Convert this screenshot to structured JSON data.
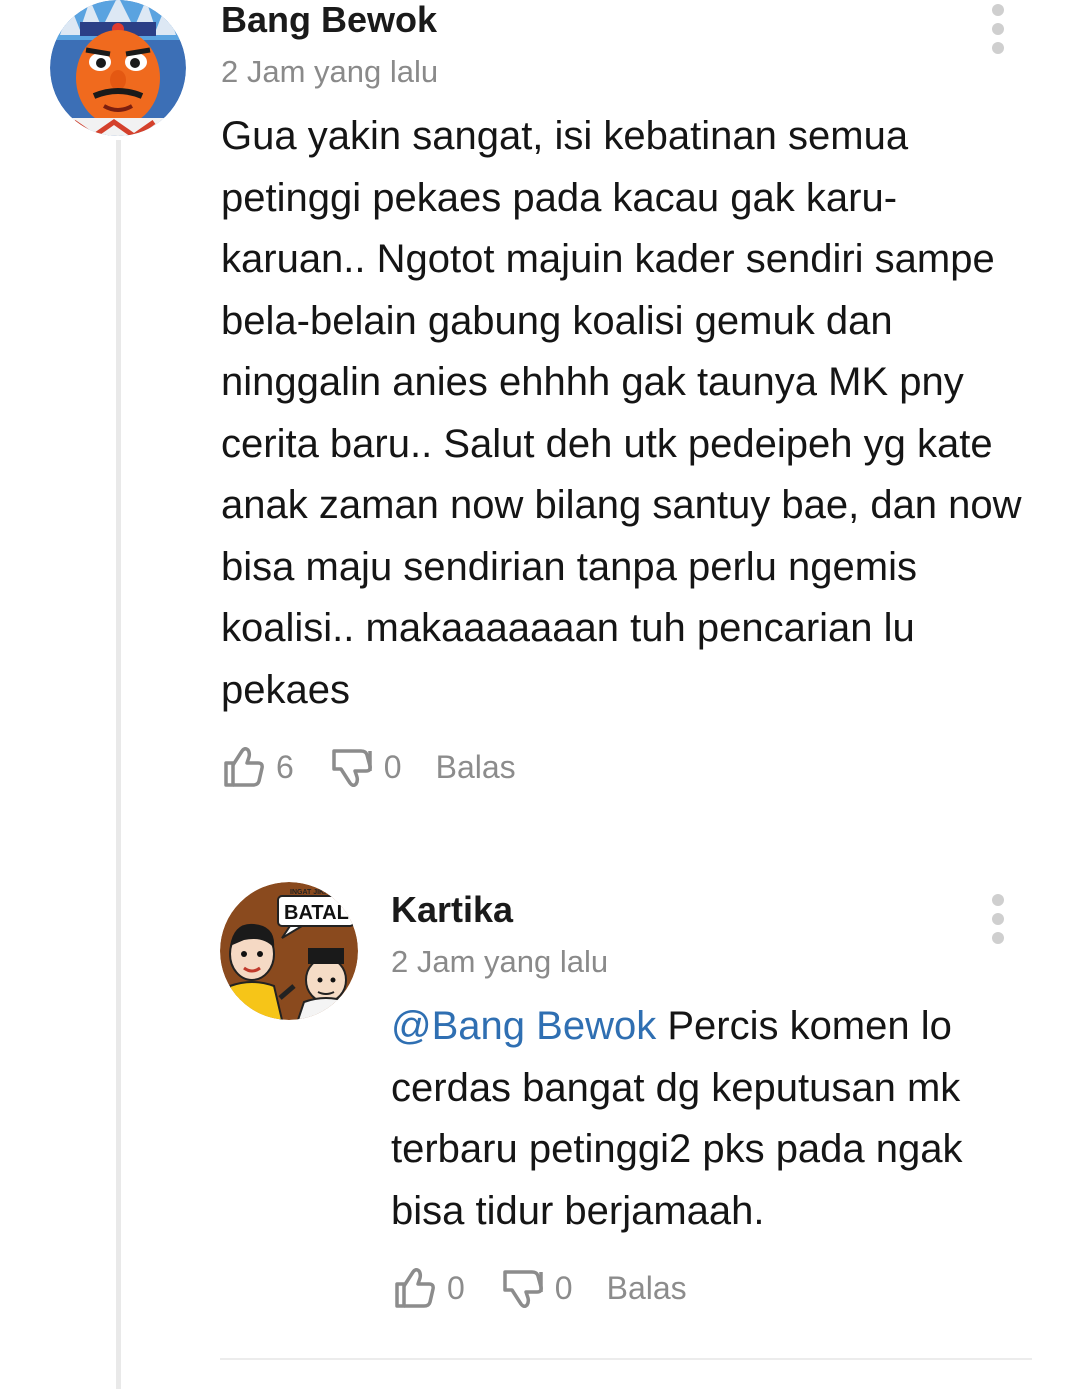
{
  "comments": [
    {
      "author": "Bang Bewok",
      "time": "2 Jam yang lalu",
      "text": "Gua yakin sangat, isi kebatinan semua petinggi pekaes pada kacau gak karu-karuan.. Ngotot majuin kader sendiri sampe bela-belain gabung koalisi gemuk dan ninggalin anies ehhhh gak taunya MK pny cerita baru.. Salut deh utk pedeipeh yg kate anak zaman now bilang santuy bae, dan now bisa maju sendirian tanpa perlu ngemis koalisi.. makaaaaaaan tuh pencarian lu pekaes",
      "likes": "6",
      "dislikes": "0",
      "reply_label": "Balas"
    }
  ],
  "replies": [
    {
      "author": "Kartika",
      "time": "2 Jam yang lalu",
      "mention": "@Bang Bewok",
      "text": " Percis komen lo cerdas bangat dg keputusan mk terbaru petinggi2 pks pada ngak bisa tidur berjamaah.",
      "likes": "0",
      "dislikes": "0",
      "reply_label": "Balas",
      "avatar_caption": "INGAT JIKA",
      "avatar_word": "BATAL"
    }
  ],
  "colors": {
    "mention": "#2f6fb2",
    "meta": "#8a8a8a",
    "icon": "#8c8c8c"
  }
}
